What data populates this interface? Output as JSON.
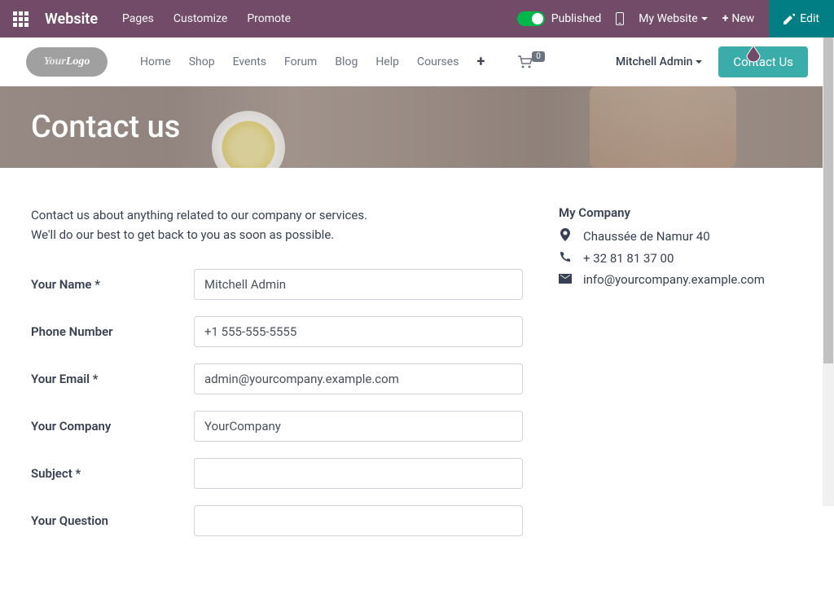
{
  "topbar": {
    "website_label": "Website",
    "menu": [
      "Pages",
      "Customize",
      "Promote"
    ],
    "published": "Published",
    "my_website": "My Website",
    "new": "New",
    "edit": "Edit"
  },
  "nav": {
    "logo_your": "Your",
    "logo_logo": "Logo",
    "links": [
      "Home",
      "Shop",
      "Events",
      "Forum",
      "Blog",
      "Help",
      "Courses"
    ],
    "cart_count": "0",
    "user": "Mitchell Admin",
    "contact_btn": "Contact Us"
  },
  "hero": {
    "title": "Contact us"
  },
  "intro": {
    "line1": "Contact us about anything related to our company or services.",
    "line2": "We'll do our best to get back to you as soon as possible."
  },
  "form": {
    "name_label": "Your Name *",
    "name_value": "Mitchell Admin",
    "phone_label": "Phone Number",
    "phone_value": "+1 555-555-5555",
    "email_label": "Your Email *",
    "email_value": "admin@yourcompany.example.com",
    "company_label": "Your Company",
    "company_value": "YourCompany",
    "subject_label": "Subject *",
    "subject_value": "",
    "question_label": "Your Question",
    "question_value": ""
  },
  "company": {
    "name": "My Company",
    "address": "Chaussée de Namur 40",
    "phone": "+ 32 81 81 37 00",
    "email": "info@yourcompany.example.com"
  }
}
